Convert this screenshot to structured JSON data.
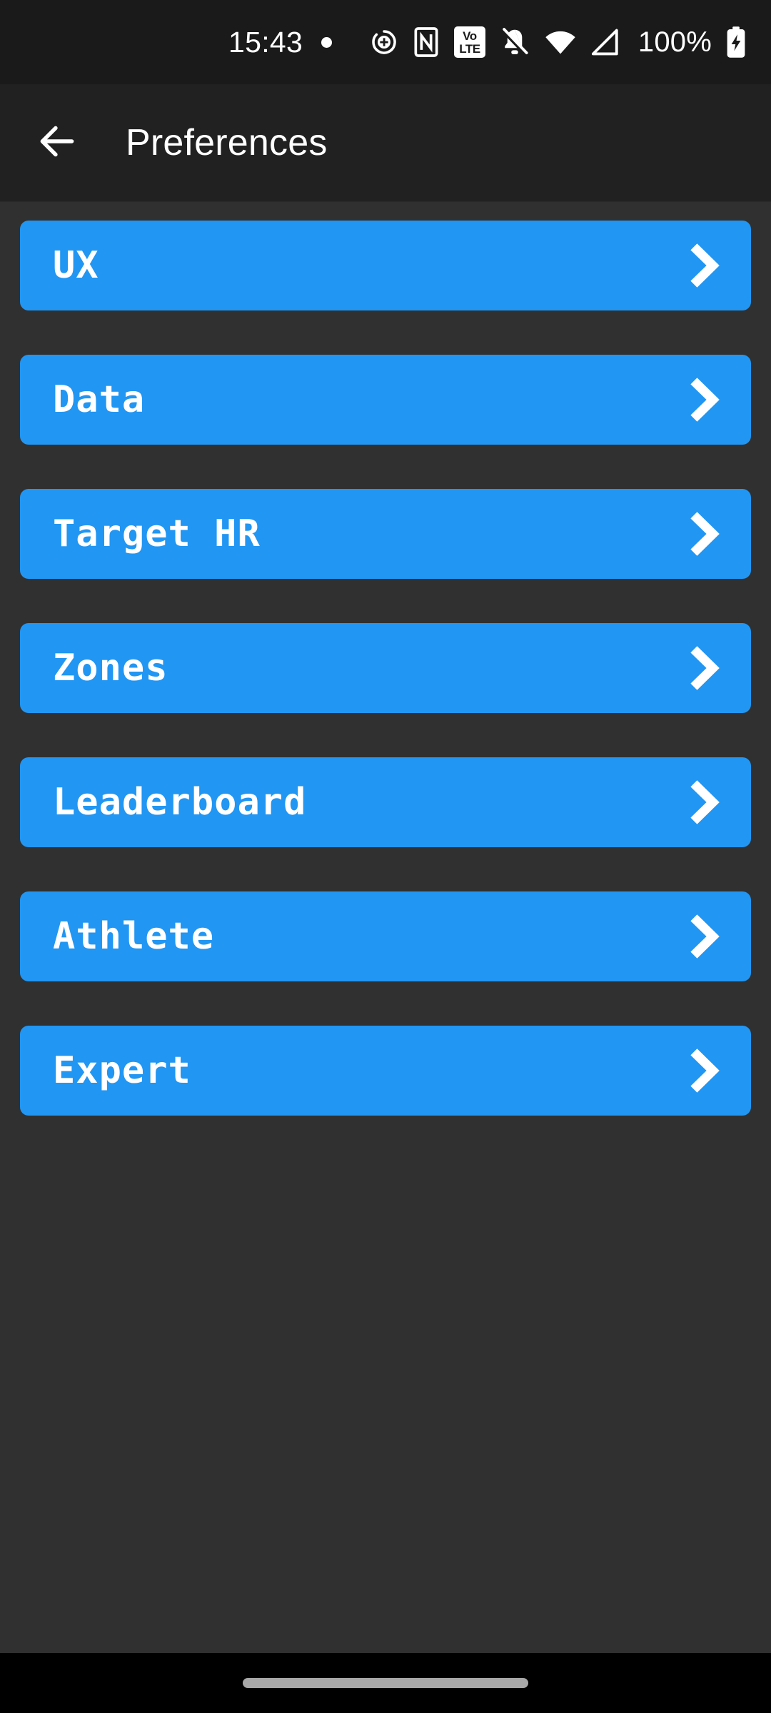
{
  "status_bar": {
    "clock": "15:43",
    "notification_dot": true,
    "icons": [
      {
        "name": "screen-record-icon",
        "label": "screen recording"
      },
      {
        "name": "nfc-icon",
        "label": "NFC"
      },
      {
        "name": "volte-icon",
        "line1": "VoLTE-top",
        "line2": "LTE"
      },
      {
        "name": "notifications-muted-icon",
        "label": "silent"
      },
      {
        "name": "wifi-icon",
        "label": "wifi"
      },
      {
        "name": "cellular-signal-icon",
        "label": "signal"
      }
    ],
    "volte_top": "Vo",
    "volte_bottom": "LTE",
    "battery_percent": "100%",
    "battery_charging": true
  },
  "app_bar": {
    "back_label": "Back",
    "title": "Preferences"
  },
  "preferences": {
    "items": [
      {
        "label": "UX"
      },
      {
        "label": "Data"
      },
      {
        "label": "Target HR"
      },
      {
        "label": "Zones"
      },
      {
        "label": "Leaderboard"
      },
      {
        "label": "Athlete"
      },
      {
        "label": "Expert"
      }
    ]
  },
  "colors": {
    "accent": "#2196f3",
    "content_background": "#303030",
    "app_bar_background": "#212121",
    "status_bar_background": "#1a1a1a",
    "nav_bar_background": "#000000",
    "text_on_accent": "#ffffff"
  },
  "nav_bar": {
    "gesture_pill": true
  }
}
